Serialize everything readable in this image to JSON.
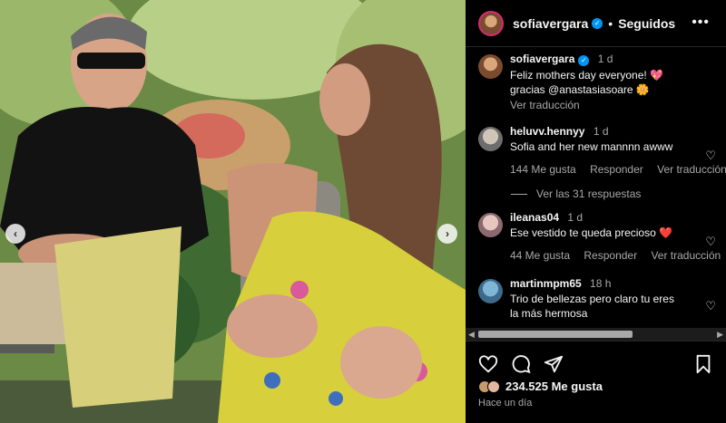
{
  "post": {
    "username": "sofiavergara",
    "follow_status": "Seguidos",
    "more_icon": "more-options-icon",
    "caption": {
      "username": "sofiavergara",
      "time": "1 d",
      "text_line1": "Feliz mothers day everyone! 💖",
      "text_line2": "gracias @anastasiasoare 🌼",
      "translate": "Ver traducción"
    },
    "comments": [
      {
        "username": "heluvv.hennyy",
        "time": "1 d",
        "text": "Sofia and her new mannnn awww",
        "likes": "144 Me gusta",
        "reply": "Responder",
        "translate": "Ver traducción",
        "view_replies": "Ver las 31 respuestas"
      },
      {
        "username": "ileanas04",
        "time": "1 d",
        "text": "Ese vestido te queda precioso ❤️",
        "likes": "44 Me gusta",
        "reply": "Responder",
        "translate": "Ver traducción"
      },
      {
        "username": "martinmpm65",
        "time": "18 h",
        "text_line1": "Trio de bellezas pero claro tu eres",
        "text_line2": "la más hermosa"
      }
    ],
    "likes_count": "234.525 Me gusta",
    "posted_ago": "Hace un día"
  },
  "icons": {
    "like": "heart-icon",
    "comment": "comment-icon",
    "share": "share-icon",
    "save": "bookmark-icon",
    "prev": "chevron-left-icon",
    "next": "chevron-right-icon"
  },
  "colors": {
    "background": "#000000",
    "text": "#f5f5f5",
    "secondary": "#a8a8a8",
    "verified": "#0095f6",
    "heart_red": "#ff3040"
  }
}
